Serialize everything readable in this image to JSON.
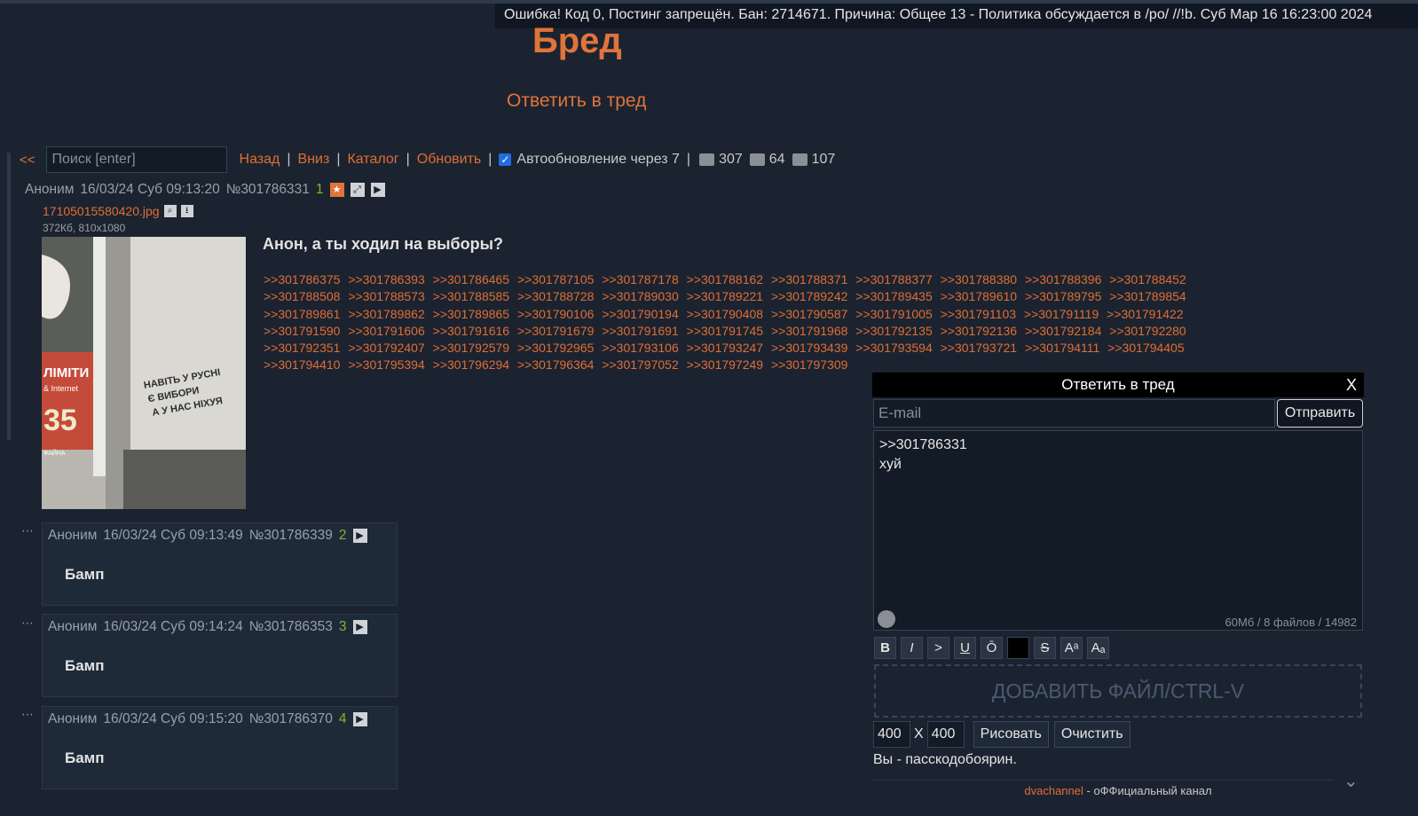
{
  "error_bar": "Ошибка! Код 0, Постинг запрещён. Бан: 2714671. Причина: Общее 13 - Политика обсуждается в /po/ //!b. Суб Мар 16 16:23:00 2024",
  "board_title": "Бред",
  "reply_thread_link": "Ответить в тред",
  "toolbar": {
    "back": "<<",
    "search_placeholder": "Поиск [enter]",
    "nav_back": "Назад",
    "nav_down": "Вниз",
    "nav_catalog": "Каталог",
    "nav_refresh": "Обновить",
    "autoupdate": "Автообновление через 7",
    "posts_count": "307",
    "images_count": "64",
    "posters_count": "107"
  },
  "op": {
    "name": "Аноним",
    "date": "16/03/24 Суб 09:13:20",
    "number": "№301786331",
    "index": "1",
    "file_name": "17105015580420.jpg",
    "file_meta": "372Кб, 810x1080",
    "subject": "Анон, а ты ходил на выборы?",
    "image_text": {
      "sign_brand": "ЛІМІТИ",
      "sign_sub": "& Internet",
      "sign_price": "35",
      "sign_bottom": "ФАЙНА",
      "graffiti": "НАВІТЬ У РУСНІ\nЄ ВИБОРИ\nА У НАС НІХУЯ"
    },
    "replies": [
      ">>301786375",
      ">>301786393",
      ">>301786465",
      ">>301787105",
      ">>301787178",
      ">>301788162",
      ">>301788371",
      ">>301788377",
      ">>301788380",
      ">>301788396",
      ">>301788452",
      ">>301788508",
      ">>301788573",
      ">>301788585",
      ">>301788728",
      ">>301789030",
      ">>301789221",
      ">>301789242",
      ">>301789435",
      ">>301789610",
      ">>301789795",
      ">>301789854",
      ">>301789861",
      ">>301789862",
      ">>301789865",
      ">>301790106",
      ">>301790194",
      ">>301790408",
      ">>301790587",
      ">>301791005",
      ">>301791103",
      ">>301791119",
      ">>301791422",
      ">>301791590",
      ">>301791606",
      ">>301791616",
      ">>301791679",
      ">>301791691",
      ">>301791745",
      ">>301791968",
      ">>301792135",
      ">>301792136",
      ">>301792184",
      ">>301792280",
      ">>301792351",
      ">>301792407",
      ">>301792579",
      ">>301792965",
      ">>301793106",
      ">>301793247",
      ">>301793439",
      ">>301793594",
      ">>301793721",
      ">>301794111",
      ">>301794405",
      ">>301794410",
      ">>301795394",
      ">>301796294",
      ">>301796364",
      ">>301797052",
      ">>301797249",
      ">>301797309"
    ]
  },
  "posts": [
    {
      "name": "Аноним",
      "date": "16/03/24 Суб 09:13:49",
      "number": "№301786339",
      "index": "2",
      "text": "Бамп"
    },
    {
      "name": "Аноним",
      "date": "16/03/24 Суб 09:14:24",
      "number": "№301786353",
      "index": "3",
      "text": "Бамп"
    },
    {
      "name": "Аноним",
      "date": "16/03/24 Суб 09:15:20",
      "number": "№301786370",
      "index": "4",
      "text": "Бамп"
    }
  ],
  "reply_form": {
    "title": "Ответить в тред",
    "close": "X",
    "email_placeholder": "E-mail",
    "send": "Отправить",
    "text": ">>301786331\nхуй",
    "limits": "60Мб / 8 файлов / 14982",
    "format_buttons": [
      "B",
      "I",
      ">",
      "U",
      "Ō",
      "",
      "S",
      "Aᵃ",
      "Aₐ"
    ],
    "dropzone": "ДОБАВИТЬ ФАЙЛ/CTRL-V",
    "width": "400",
    "x_label": "X",
    "height": "400",
    "draw": "Рисовать",
    "clear": "Очистить",
    "note": "Вы - пасскодобоярин.",
    "footer_link": "dvachannel",
    "footer_text": " - оФФициальный канал"
  },
  "colors": {
    "accent": "#e0743a",
    "background": "#1b2330",
    "green_index": "#86b52f"
  }
}
